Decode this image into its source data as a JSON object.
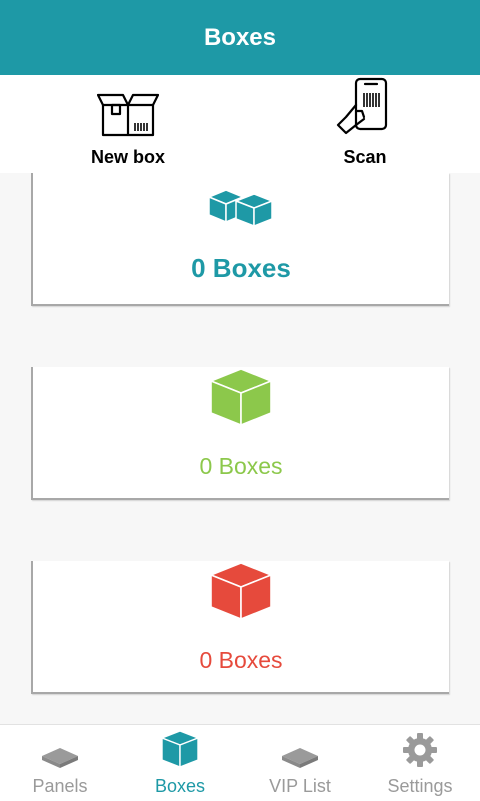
{
  "app_bar": {
    "title": "Boxes"
  },
  "actions": [
    {
      "label": "New box",
      "icon": "open-box-icon"
    },
    {
      "label": "Scan",
      "icon": "phone-scan-icon"
    }
  ],
  "cards": [
    {
      "count_text": "0 Boxes",
      "color": "#1e99a6",
      "icon": "multiple-boxes-icon"
    },
    {
      "count_text": "0 Boxes",
      "color": "#8cc84b",
      "icon": "box-icon"
    },
    {
      "count_text": "0 Boxes",
      "color": "#e64a3c",
      "icon": "box-icon"
    }
  ],
  "bottom_nav": {
    "items": [
      {
        "label": "Panels",
        "icon": "panel-icon"
      },
      {
        "label": "Boxes",
        "icon": "box-icon",
        "active": true
      },
      {
        "label": "VIP List",
        "icon": "panel-icon"
      },
      {
        "label": "Settings",
        "icon": "gear-icon"
      }
    ]
  },
  "colors": {
    "primary": "#1e99a6",
    "inactive": "#9a9a9a",
    "green": "#8cc84b",
    "red": "#e64a3c"
  }
}
